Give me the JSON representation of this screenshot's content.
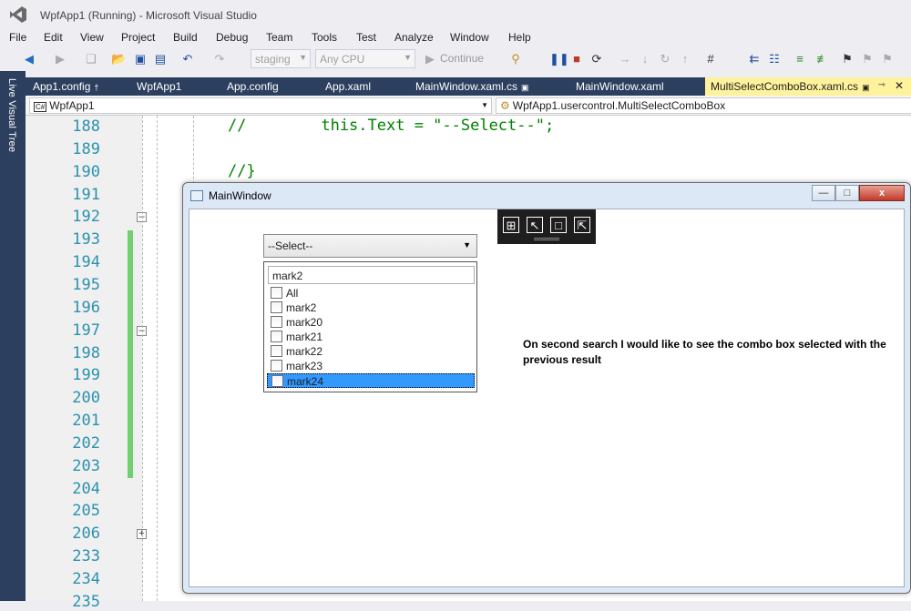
{
  "window_title": "WpfApp1 (Running) - Microsoft Visual Studio",
  "menu": [
    "File",
    "Edit",
    "View",
    "Project",
    "Build",
    "Debug",
    "Team",
    "Tools",
    "Test",
    "Analyze",
    "Window",
    "Help"
  ],
  "toolbar": {
    "branch_combo": "staging",
    "platform_combo": "Any CPU",
    "continue_label": "Continue"
  },
  "left_strip_label": "Live Visual Tree",
  "tabs": [
    {
      "label": "App1.config",
      "pin": "†"
    },
    {
      "label": "WpfApp1",
      "pin": ""
    },
    {
      "label": "App.config",
      "pin": ""
    },
    {
      "label": "App.xaml",
      "pin": ""
    },
    {
      "label": "MainWindow.xaml.cs",
      "pin": "🔒"
    },
    {
      "label": "MainWindow.xaml",
      "pin": ""
    },
    {
      "label": "MultiSelectComboBox.xaml.cs",
      "pin": "🔒",
      "active": true
    }
  ],
  "tab_controls": {
    "pin": "→",
    "close": "✕"
  },
  "navbar": {
    "project": "WpfApp1",
    "project_badge": "C#",
    "member": "WpfApp1.usercontrol.MultiSelectComboBox"
  },
  "editor": {
    "line_numbers": [
      "188",
      "189",
      "190",
      "191",
      "192",
      "193",
      "194",
      "195",
      "196",
      "197",
      "198",
      "199",
      "200",
      "201",
      "202",
      "203",
      "204",
      "205",
      "206",
      "233",
      "234",
      "235"
    ],
    "code_line_1": "//        this.Text = \"--Select--\";",
    "code_line_2": "//}"
  },
  "wpf_window": {
    "caption": "MainWindow",
    "combo_value": "--Select--",
    "search_text": "mark2",
    "options": [
      "All",
      "mark2",
      "mark20",
      "mark21",
      "mark22",
      "mark23",
      "mark24"
    ],
    "selected_option": "mark24",
    "note": "On second search I would like to see the combo box selected with the previous result",
    "min_button": "—",
    "max_button": "□",
    "close_button": "x"
  }
}
